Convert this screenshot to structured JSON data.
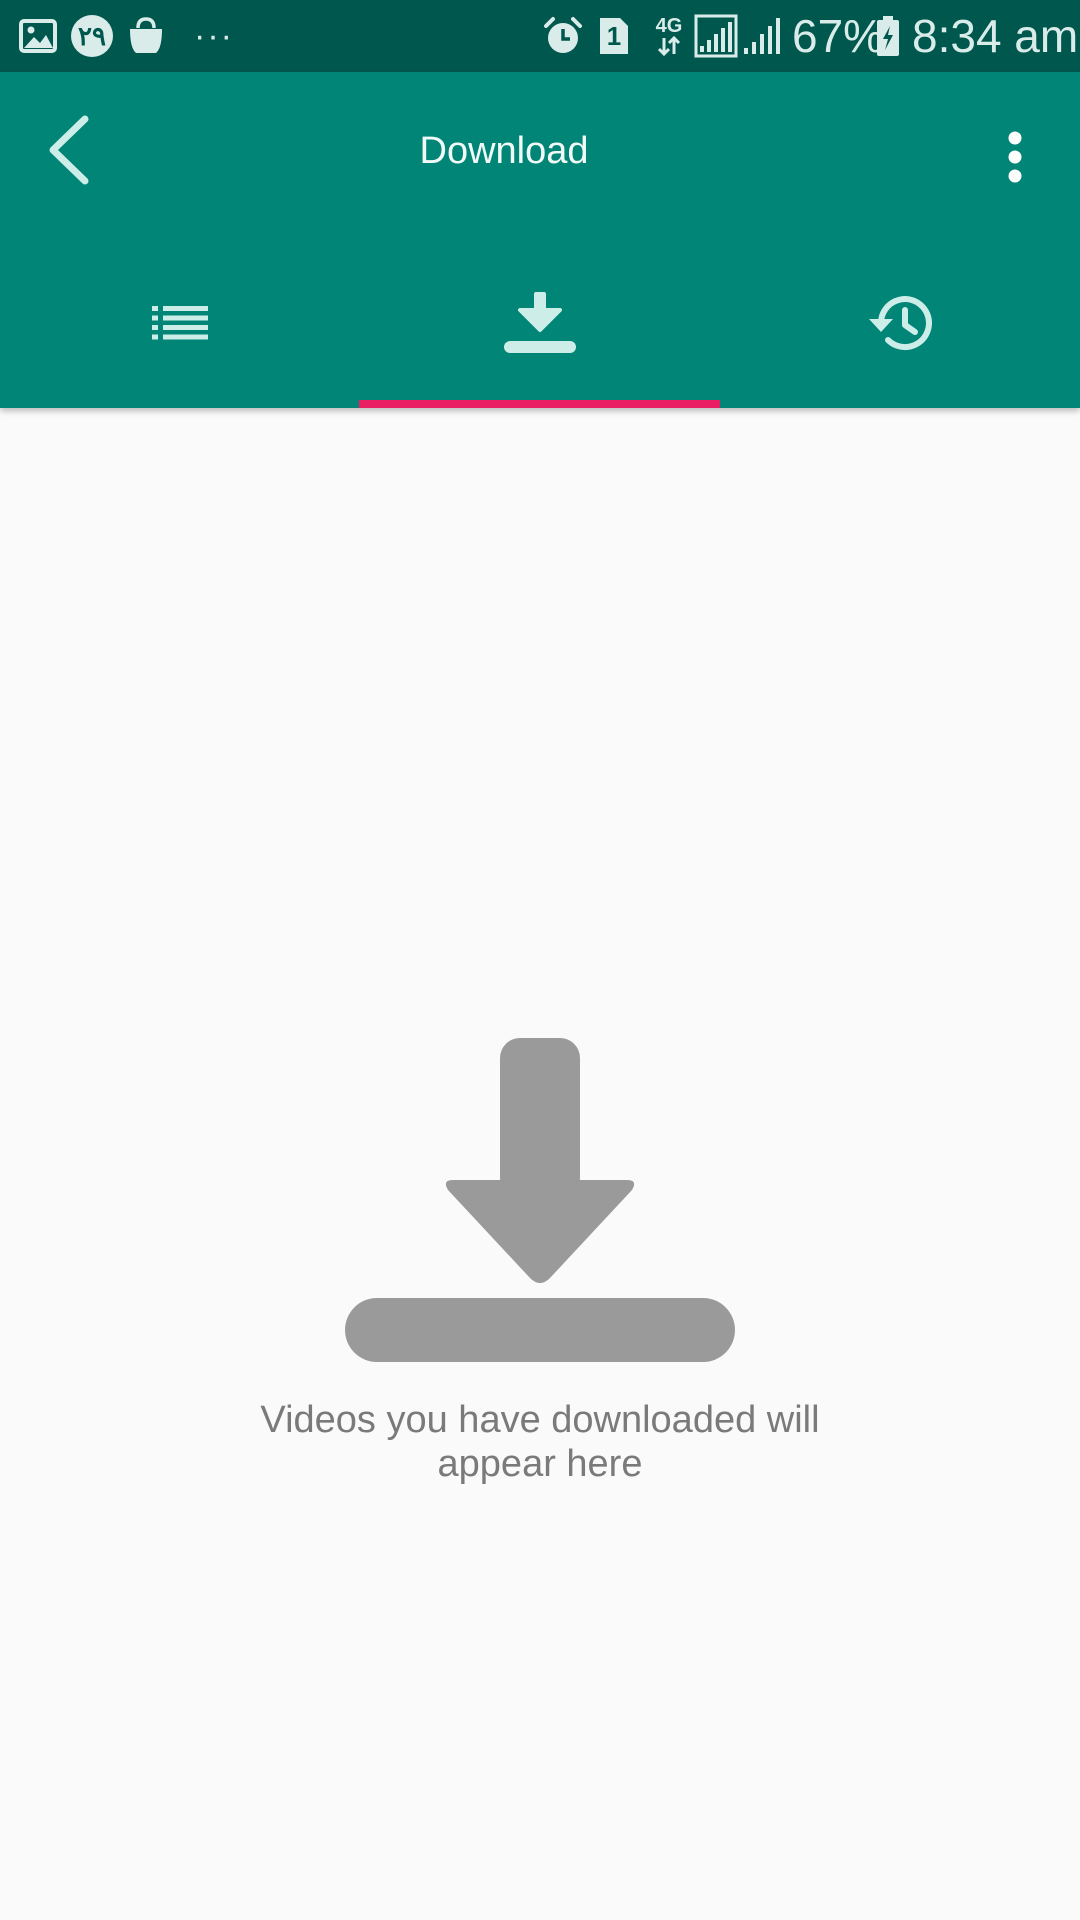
{
  "status_bar": {
    "left_icons": [
      "gallery-icon",
      "calendar-badge-icon",
      "shopping-bag-icon",
      "more-notifications-icon"
    ],
    "calendar_badge": "٢٩",
    "more_notifications": "···",
    "right_icons": [
      "alarm-icon",
      "sim-1-icon",
      "4g-data-icon",
      "signal-icon",
      "signal-2-icon",
      "battery-charging-icon"
    ],
    "sim_label": "1",
    "network": "4G",
    "battery": "67%",
    "time": "8:34 am"
  },
  "app_bar": {
    "title": "Download",
    "back_icon": "back-arrow-icon",
    "overflow_icon": "more-vert-icon",
    "background": "#008577",
    "status_background": "#00574e"
  },
  "tabs": [
    {
      "name": "list",
      "icon": "list-icon",
      "selected": false
    },
    {
      "name": "download",
      "icon": "download-icon",
      "selected": true
    },
    {
      "name": "history",
      "icon": "history-icon",
      "selected": false
    }
  ],
  "indicator_color": "#e91e63",
  "empty_state": {
    "icon": "download-icon",
    "message": "Videos you have downloaded will appear here"
  }
}
